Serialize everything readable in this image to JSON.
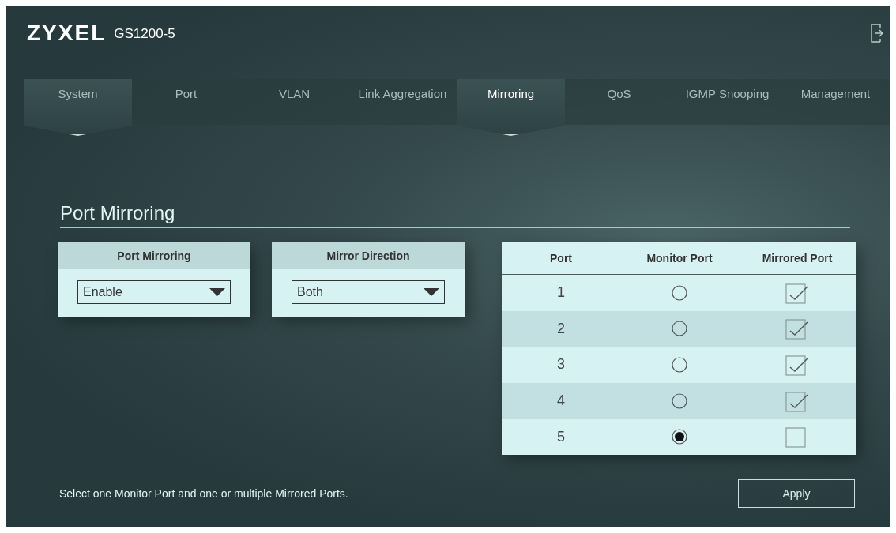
{
  "header": {
    "brand": "ZYXEL",
    "model": "GS1200-5"
  },
  "tabs": [
    {
      "label": "System",
      "selected": false,
      "hovered": true
    },
    {
      "label": "Port",
      "selected": false,
      "hovered": false
    },
    {
      "label": "VLAN",
      "selected": false,
      "hovered": false
    },
    {
      "label": "Link Aggregation",
      "selected": false,
      "hovered": false
    },
    {
      "label": "Mirroring",
      "selected": true,
      "hovered": false
    },
    {
      "label": "QoS",
      "selected": false,
      "hovered": false
    },
    {
      "label": "IGMP Snooping",
      "selected": false,
      "hovered": false
    },
    {
      "label": "Management",
      "selected": false,
      "hovered": false
    }
  ],
  "section_title": "Port Mirroring",
  "settings": [
    {
      "label": "Port Mirroring",
      "value": "Enable"
    },
    {
      "label": "Mirror Direction",
      "value": "Both"
    }
  ],
  "table": {
    "columns": [
      "Port",
      "Monitor Port",
      "Mirrored Port"
    ],
    "rows": [
      {
        "port": "1",
        "monitor_selected": false,
        "mirrored_checked": true
      },
      {
        "port": "2",
        "monitor_selected": false,
        "mirrored_checked": true
      },
      {
        "port": "3",
        "monitor_selected": false,
        "mirrored_checked": true
      },
      {
        "port": "4",
        "monitor_selected": false,
        "mirrored_checked": true
      },
      {
        "port": "5",
        "monitor_selected": true,
        "mirrored_checked": false
      }
    ]
  },
  "hint": "Select one Monitor Port and one or multiple Mirrored Ports.",
  "apply_button": "Apply"
}
